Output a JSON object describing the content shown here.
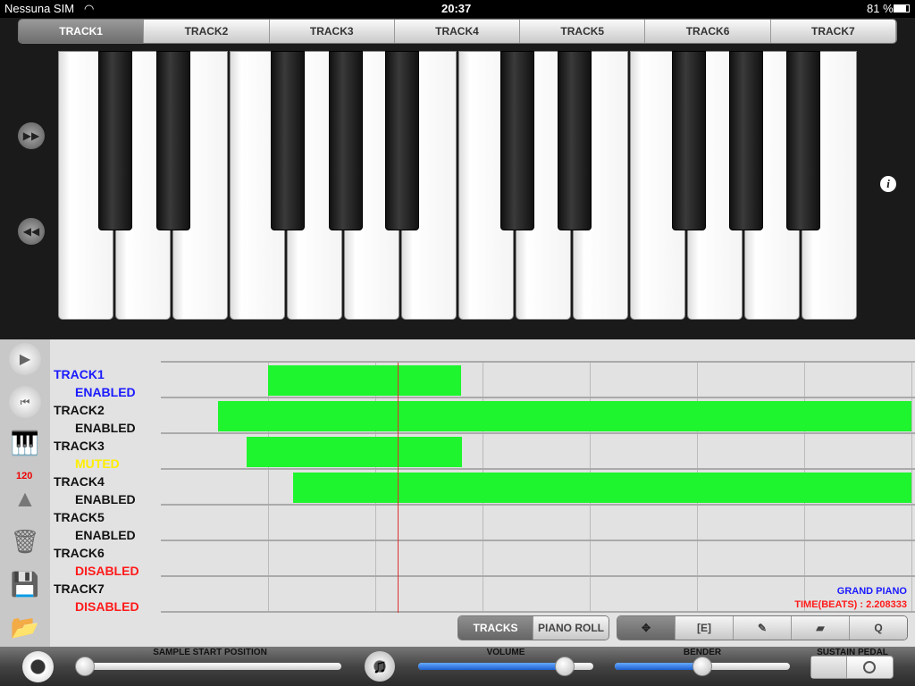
{
  "status_bar": {
    "carrier": "Nessuna SIM",
    "time": "20:37",
    "battery": "81 %"
  },
  "tabs": [
    "TRACK1",
    "TRACK2",
    "TRACK3",
    "TRACK4",
    "TRACK5",
    "TRACK6",
    "TRACK7"
  ],
  "active_tab": "TRACK1",
  "tempo": "120",
  "tracks": [
    {
      "name": "TRACK1",
      "status": "ENABLED",
      "name_color": "#1a1aff",
      "status_color": "#1a1aff",
      "bar": [
        1.0,
        2.8
      ]
    },
    {
      "name": "TRACK2",
      "status": "ENABLED",
      "name_color": "#111111",
      "status_color": "#111111",
      "bar": [
        0.53,
        7.0
      ]
    },
    {
      "name": "TRACK3",
      "status": "MUTED",
      "name_color": "#111111",
      "status_color": "#ffee00",
      "bar": [
        0.8,
        2.81
      ]
    },
    {
      "name": "TRACK4",
      "status": "ENABLED",
      "name_color": "#111111",
      "status_color": "#111111",
      "bar": [
        1.23,
        7.0
      ]
    },
    {
      "name": "TRACK5",
      "status": "ENABLED",
      "name_color": "#111111",
      "status_color": "#111111",
      "bar": null
    },
    {
      "name": "TRACK6",
      "status": "DISABLED",
      "name_color": "#111111",
      "status_color": "#ff1a1a",
      "bar": null
    },
    {
      "name": "TRACK7",
      "status": "DISABLED",
      "name_color": "#111111",
      "status_color": "#ff1a1a",
      "bar": null
    }
  ],
  "playhead_beats": 2.208333,
  "instrument": "GRAND PIANO",
  "time_readout": "TIME(BEATS) : 2.208333",
  "view_toggle": {
    "tracks": "TRACKS",
    "piano_roll": "PIANO ROLL",
    "active": "TRACKS"
  },
  "tools": [
    {
      "icon": "move-icon",
      "glyph": "✥"
    },
    {
      "icon": "select-icon",
      "glyph": "[E]"
    },
    {
      "icon": "pencil-icon",
      "glyph": "✎"
    },
    {
      "icon": "eraser-icon",
      "glyph": "▰"
    },
    {
      "icon": "quantize",
      "glyph": "Q"
    }
  ],
  "bottom": {
    "sample_label": "SAMPLE START POSITION",
    "sample_value": 0,
    "volume_label": "VOLUME",
    "volume_value": 0.88,
    "bender_label": "BENDER",
    "bender_value": 0.5,
    "sustain_label": "SUSTAIN PEDAL",
    "sustain_on": false
  },
  "colors": {
    "note_bar": "#1ef52e",
    "playhead": "#e03030",
    "accent_blue": "#1a1aff"
  }
}
